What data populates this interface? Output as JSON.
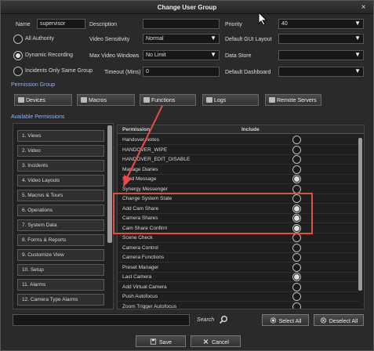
{
  "window": {
    "title": "Change User Group",
    "close_glyph": "×"
  },
  "form": {
    "name_label": "Name",
    "name_value": "supervisor",
    "description_label": "Description",
    "description_value": "",
    "priority_label": "Priority",
    "priority_value": "40",
    "all_authority_label": "All Authority",
    "dynamic_recording_label": "Dynamic Recording",
    "incidents_only_label": "Incidents Only Same Group",
    "video_sensitivity_label": "Video Sensitivity",
    "video_sensitivity_value": "Normal",
    "max_video_windows_label": "Max Video Windows",
    "max_video_windows_value": "No Limit",
    "timeout_label": "Timeout (Mins)",
    "timeout_value": "0",
    "default_gui_layout_label": "Default GUI Layout",
    "default_gui_layout_value": "",
    "data_store_label": "Data Store",
    "data_store_value": "",
    "default_dashboard_label": "Default Dashboard",
    "default_dashboard_value": ""
  },
  "permission_group": {
    "label": "Permission Group",
    "buttons": [
      "Devices",
      "Macros",
      "Functions",
      "Logs",
      "Remote Servers"
    ]
  },
  "available_permissions": {
    "label": "Available Permissions",
    "categories": [
      "1. Views",
      "2. Video",
      "3. Incidents",
      "4. Video Layouts",
      "5. Macros & Tours",
      "6. Operations",
      "7. System Data",
      "8. Forms & Reports",
      "9. Customize View",
      "10. Setup",
      "11. Alarms",
      "12. Camera Type Alarms"
    ]
  },
  "permissions_table": {
    "col_permission": "Permission",
    "col_include": "Include",
    "rows": [
      {
        "name": "Handover Notes",
        "included": false
      },
      {
        "name": "HANDOVER_WIPE",
        "included": false
      },
      {
        "name": "HANDOVER_EDIT_DISABLE",
        "included": false
      },
      {
        "name": "Manage Diaries",
        "included": false
      },
      {
        "name": "Send Message",
        "included": true
      },
      {
        "name": "Synergy Messenger",
        "included": false
      },
      {
        "name": "Change System State",
        "included": false
      },
      {
        "name": "Add Cam Share",
        "included": true
      },
      {
        "name": "Camera Shares",
        "included": true
      },
      {
        "name": "Cam Share Confirm",
        "included": true
      },
      {
        "name": "Scene Check",
        "included": false
      },
      {
        "name": "Camera Control",
        "included": false
      },
      {
        "name": "Camera Functions",
        "included": false
      },
      {
        "name": "Preset Manager",
        "included": false
      },
      {
        "name": "Last Camera",
        "included": true
      },
      {
        "name": "Add Virtual Camera",
        "included": false
      },
      {
        "name": "Push Autofocus",
        "included": false
      },
      {
        "name": "Zoom Trigger Autofocus",
        "included": false
      }
    ]
  },
  "bottom": {
    "search_label": "Search",
    "select_all": "Select All",
    "deselect_all": "Deselect All",
    "save": "Save",
    "cancel": "Cancel"
  },
  "colors": {
    "highlight": "#e84a4a",
    "accent_label": "#8ab4ff"
  }
}
